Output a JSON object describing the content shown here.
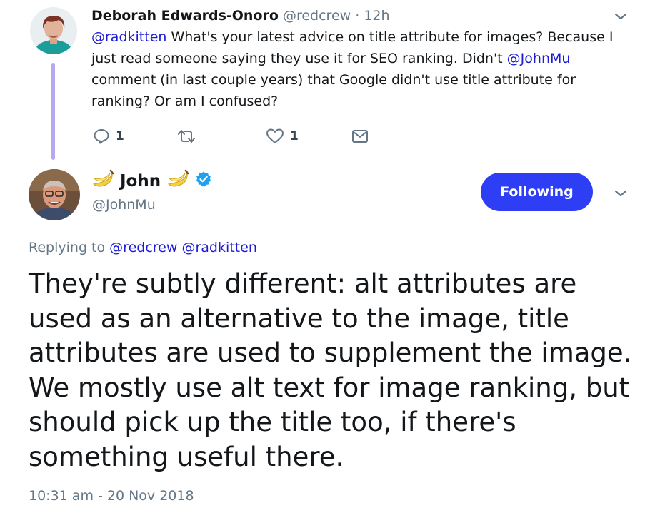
{
  "parent_tweet": {
    "author_name": "Deborah Edwards-Onoro",
    "author_handle": "@redcrew",
    "separator": "·",
    "time": "12h",
    "mention_1": "@radkitten",
    "text_1": " What's your latest advice on title attribute for images? Because I just read someone saying they use it for SEO ranking. Didn't ",
    "mention_2": "@JohnMu",
    "text_2": " comment (in last couple years) that Google didn't use title attribute for ranking? Or am I confused?",
    "actions": {
      "reply_count": "1",
      "like_count": "1"
    }
  },
  "main_tweet": {
    "author_name": "John",
    "name_emoji": "banana-icon",
    "verified": "verified-badge-icon",
    "author_handle": "@JohnMu",
    "follow_button_label": "Following",
    "replying_to_label": "Replying to",
    "replying_to_mention_1": "@redcrew",
    "replying_to_mention_2": "@radkitten",
    "body": "They're subtly different: alt attributes are used as an alternative to the image, title attributes are used to supplement the image. We mostly use alt text for image ranking, but should pick up the title too, if there's something useful there.",
    "timestamp": "10:31 am - 20 Nov 2018"
  },
  "colors": {
    "accent": "#1b1bd8",
    "follow_button": "#2d3ef5",
    "thread_line": "#b7a8f0",
    "muted_text": "#657786",
    "verified": "#1da1f2"
  }
}
